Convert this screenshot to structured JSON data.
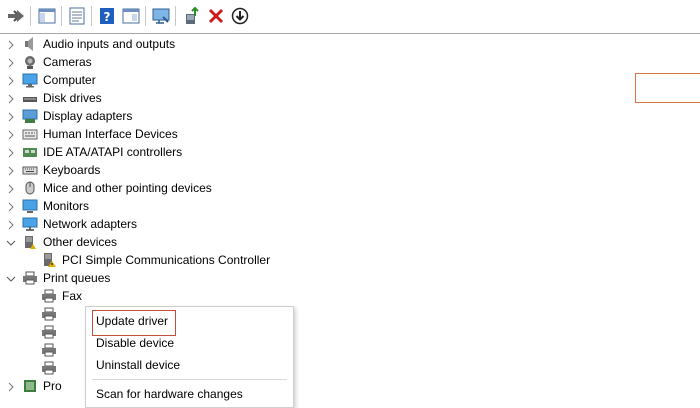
{
  "toolbar": {
    "buttons": [
      {
        "name": "back-icon"
      },
      {
        "name": "console-tree-icon"
      },
      {
        "name": "properties-icon"
      },
      {
        "name": "help-icon"
      },
      {
        "name": "show-hidden-icon"
      },
      {
        "name": "scan-monitor-icon"
      },
      {
        "name": "update-driver-icon"
      },
      {
        "name": "uninstall-icon"
      },
      {
        "name": "download-icon"
      }
    ],
    "colors": {
      "help_blue": "#1f5fbf",
      "delete_red": "#d11a1a",
      "update_green": "#2e8b2e"
    }
  },
  "tree": {
    "items": [
      {
        "label": "Audio inputs and outputs",
        "icon": "speaker-icon",
        "expanded": false
      },
      {
        "label": "Cameras",
        "icon": "camera-icon",
        "expanded": false
      },
      {
        "label": "Computer",
        "icon": "computer-icon",
        "expanded": false
      },
      {
        "label": "Disk drives",
        "icon": "disk-drive-icon",
        "expanded": false
      },
      {
        "label": "Display adapters",
        "icon": "display-adapter-icon",
        "expanded": false
      },
      {
        "label": "Human Interface Devices",
        "icon": "hid-icon",
        "expanded": false
      },
      {
        "label": "IDE ATA/ATAPI controllers",
        "icon": "ide-controller-icon",
        "expanded": false
      },
      {
        "label": "Keyboards",
        "icon": "keyboard-icon",
        "expanded": false
      },
      {
        "label": "Mice and other pointing devices",
        "icon": "mouse-icon",
        "expanded": false
      },
      {
        "label": "Monitors",
        "icon": "monitor-icon",
        "expanded": false
      },
      {
        "label": "Network adapters",
        "icon": "network-adapter-icon",
        "expanded": false
      },
      {
        "label": "Other devices",
        "icon": "other-devices-icon",
        "expanded": true
      },
      {
        "label": "PCI Simple Communications Controller",
        "icon": "unknown-device-icon",
        "child": true
      },
      {
        "label": "Print queues",
        "icon": "printer-icon",
        "expanded": true
      },
      {
        "label": "Fax",
        "icon": "printer-icon",
        "child": true
      },
      {
        "label": "",
        "icon": "printer-icon",
        "child": true,
        "selected": true
      },
      {
        "label": "",
        "icon": "printer-icon",
        "child": true
      },
      {
        "label": "",
        "icon": "printer-icon",
        "child": true
      },
      {
        "label": "",
        "icon": "printer-icon",
        "child": true
      },
      {
        "label": "Pro",
        "icon": "processor-icon",
        "expanded": false
      }
    ]
  },
  "context_menu": {
    "items": [
      {
        "label": "Update driver",
        "highlighted": true
      },
      {
        "label": "Disable device"
      },
      {
        "label": "Uninstall device"
      },
      {
        "label": "Scan for hardware changes"
      }
    ],
    "highlight_color": "#c0503a"
  }
}
